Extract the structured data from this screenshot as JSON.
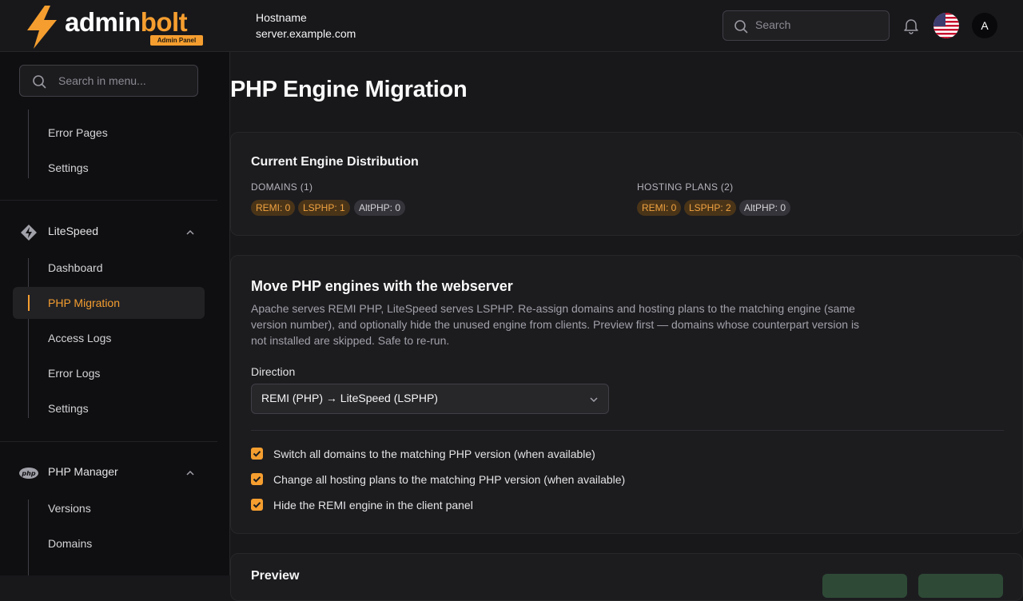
{
  "header": {
    "logo": {
      "brand_main": "admin",
      "brand_accent": "bolt",
      "badge": "Admin Panel"
    },
    "hostname_label": "Hostname",
    "hostname_value": "server.example.com",
    "search_placeholder": "Search",
    "avatar_initial": "A"
  },
  "sidebar": {
    "search_placeholder": "Search in menu...",
    "top_items": [
      "Error Pages",
      "Settings"
    ],
    "groups": [
      {
        "label": "LiteSpeed",
        "icon": "litespeed-icon",
        "expanded": true,
        "items": [
          "Dashboard",
          "PHP Migration",
          "Access Logs",
          "Error Logs",
          "Settings"
        ],
        "active": "PHP Migration"
      },
      {
        "label": "PHP Manager",
        "icon": "php-icon",
        "expanded": true,
        "items": [
          "Versions",
          "Domains"
        ]
      }
    ]
  },
  "main": {
    "title": "PHP Engine Migration",
    "distribution": {
      "title": "Current Engine Distribution",
      "domains_label": "DOMAINS (1)",
      "domains": [
        "REMI: 0",
        "LSPHP: 1",
        "AltPHP: 0"
      ],
      "plans_label": "HOSTING PLANS (2)",
      "plans": [
        "REMI: 0",
        "LSPHP: 2",
        "AltPHP: 0"
      ]
    },
    "move": {
      "title": "Move PHP engines with the webserver",
      "description": "Apache serves REMI PHP, LiteSpeed serves LSPHP. Re-assign domains and hosting plans to the matching engine (same version number), and optionally hide the unused engine from clients. Preview first — domains whose counterpart version is not installed are skipped. Safe to re-run.",
      "direction_label": "Direction",
      "direction_value": "REMI (PHP) → LiteSpeed (LSPHP)",
      "options": [
        {
          "label": "Switch all domains to the matching PHP version (when available)",
          "checked": true
        },
        {
          "label": "Change all hosting plans to the matching PHP version (when available)",
          "checked": true
        },
        {
          "label": "Hide the REMI engine in the client panel",
          "checked": true
        }
      ]
    },
    "preview": {
      "title": "Preview"
    }
  },
  "colors": {
    "accent": "#f59e2f",
    "background": "#18181b",
    "sidebar": "#0f0f11",
    "card": "#1c1c1f"
  }
}
